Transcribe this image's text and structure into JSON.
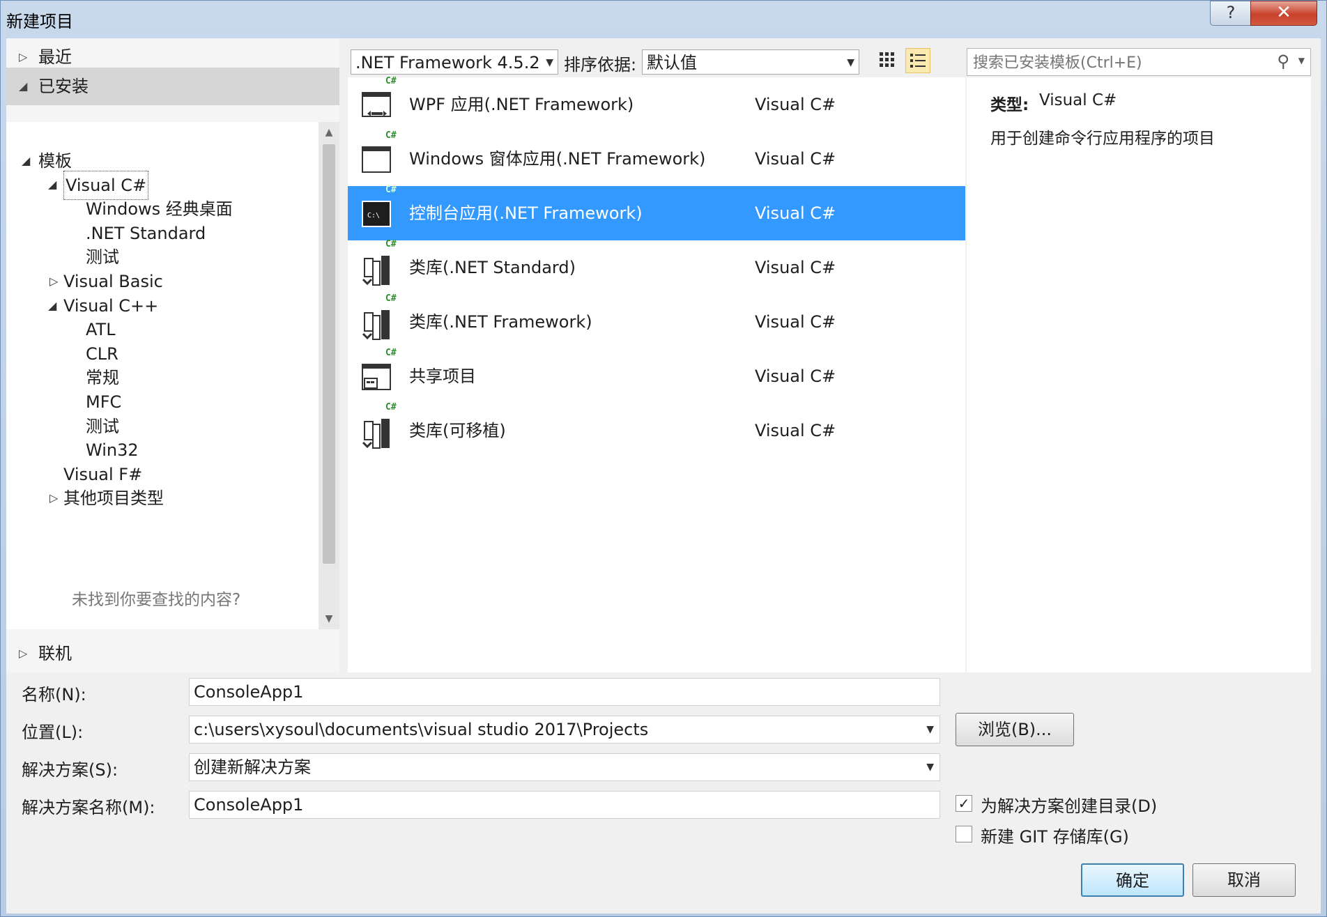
{
  "window": {
    "title": "新建项目",
    "help": "?",
    "close": "✕"
  },
  "nav": {
    "recent": "最近",
    "installed": "已安装",
    "online": "联机"
  },
  "tree": {
    "templates": "模板",
    "visual_cs": "Visual C#",
    "windows_desktop": "Windows 经典桌面",
    "net_standard": ".NET Standard",
    "test_cs": "测试",
    "visual_basic": "Visual Basic",
    "visual_cpp": "Visual C++",
    "atl": "ATL",
    "clr": "CLR",
    "general": "常规",
    "mfc": "MFC",
    "test_cpp": "测试",
    "win32": "Win32",
    "visual_fs": "Visual F#",
    "other_types": "其他项目类型",
    "hint": "未找到你要查找的内容?"
  },
  "toolbar": {
    "framework": ".NET Framework 4.5.2",
    "sort_label": "排序依据:",
    "sort_value": "默认值",
    "search_placeholder": "搜索已安装模板(Ctrl+E)"
  },
  "templates": [
    {
      "name": "WPF 应用(.NET Framework)",
      "lang": "Visual C#",
      "icon": "wpf-app-icon"
    },
    {
      "name": "Windows 窗体应用(.NET Framework)",
      "lang": "Visual C#",
      "icon": "winforms-app-icon"
    },
    {
      "name": "控制台应用(.NET Framework)",
      "lang": "Visual C#",
      "icon": "console-app-icon"
    },
    {
      "name": "类库(.NET Standard)",
      "lang": "Visual C#",
      "icon": "class-library-icon"
    },
    {
      "name": "类库(.NET Framework)",
      "lang": "Visual C#",
      "icon": "class-library-icon"
    },
    {
      "name": "共享项目",
      "lang": "Visual C#",
      "icon": "shared-project-icon"
    },
    {
      "name": "类库(可移植)",
      "lang": "Visual C#",
      "icon": "class-library-icon"
    }
  ],
  "details": {
    "type_label": "类型:",
    "type_value": "Visual C#",
    "description": "用于创建命令行应用程序的项目"
  },
  "form": {
    "name_label": "名称(N):",
    "name_value": "ConsoleApp1",
    "location_label": "位置(L):",
    "location_value": "c:\\users\\xysoul\\documents\\visual studio 2017\\Projects",
    "browse": "浏览(B)...",
    "solution_label": "解决方案(S):",
    "solution_value": "创建新解决方案",
    "solution_name_label": "解决方案名称(M):",
    "solution_name_value": "ConsoleApp1",
    "create_dir_label": "为解决方案创建目录(D)",
    "create_dir_checked": true,
    "git_label": "新建 GIT 存储库(G)",
    "git_checked": false,
    "ok": "确定",
    "cancel": "取消"
  }
}
